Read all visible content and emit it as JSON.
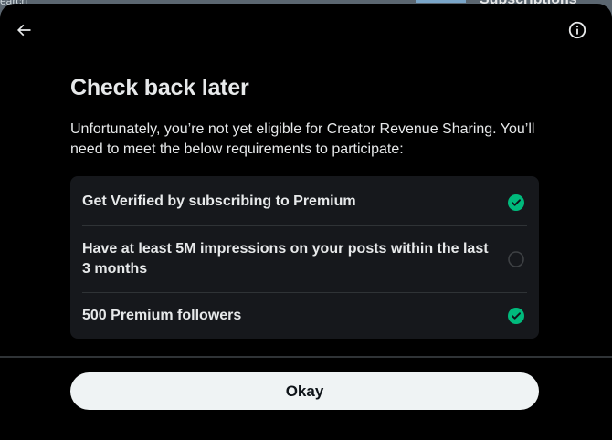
{
  "background": {
    "left_peek_text": "earch",
    "right_peek_text": "Subscriptions"
  },
  "header": {
    "back_icon": "arrow-left-icon",
    "info_icon": "info-circle-icon"
  },
  "content": {
    "title": "Check back later",
    "description": "Unfortunately, you’re not yet eligible for Creator Revenue Sharing. You’ll need to meet the below requirements to participate:",
    "requirements": [
      {
        "label": "Get Verified by subscribing to Premium",
        "met": true,
        "status_icon": "check-circle-icon"
      },
      {
        "label": "Have at least 5M impressions on your posts within the last 3 months",
        "met": false,
        "status_icon": "empty-circle-icon"
      },
      {
        "label": "500 Premium followers",
        "met": true,
        "status_icon": "check-circle-icon"
      }
    ]
  },
  "footer": {
    "okay_label": "Okay"
  },
  "colors": {
    "accent_green": "#00ba7c",
    "modal_bg": "#000000",
    "card_bg": "#16181c",
    "button_bg": "#eff3f4",
    "text_primary": "#e7e9ea"
  }
}
